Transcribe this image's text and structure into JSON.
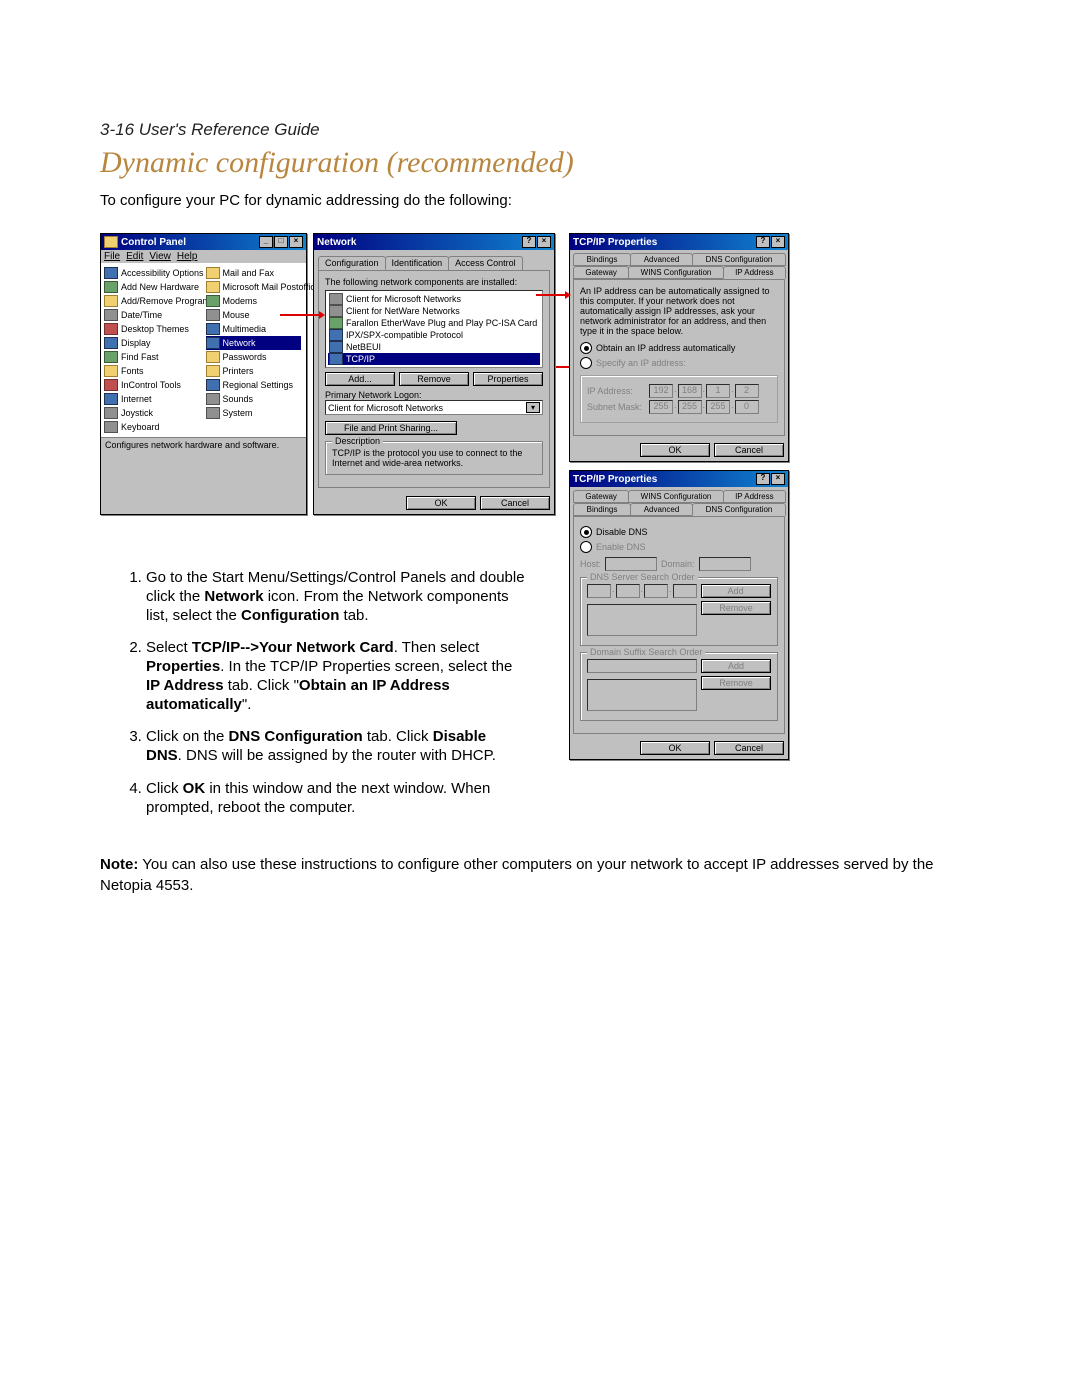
{
  "header": "3-16  User's Reference Guide",
  "title": "Dynamic configuration (recommended)",
  "intro": "To configure your PC for dynamic addressing do the following:",
  "control_panel": {
    "title": "Control Panel",
    "menu": [
      "File",
      "Edit",
      "View",
      "Help"
    ],
    "items_left": [
      "Accessibility Options",
      "Add New Hardware",
      "Add/Remove Programs",
      "Date/Time",
      "Desktop Themes",
      "Display",
      "Find Fast",
      "Fonts",
      "InControl Tools",
      "Internet",
      "Joystick",
      "Keyboard"
    ],
    "items_right": [
      "Mail and Fax",
      "Microsoft Mail Postoffice",
      "Modems",
      "Mouse",
      "Multimedia",
      "Network",
      "Passwords",
      "Printers",
      "Regional Settings",
      "Sounds",
      "System"
    ],
    "selected": "Network",
    "status": "Configures network hardware and software."
  },
  "network": {
    "title": "Network",
    "tabs": [
      "Configuration",
      "Identification",
      "Access Control"
    ],
    "list_label": "The following network components are installed:",
    "components": [
      "Client for Microsoft Networks",
      "Client for NetWare Networks",
      "Farallon EtherWave Plug and Play PC-ISA Card",
      "IPX/SPX-compatible Protocol",
      "NetBEUI",
      "TCP/IP"
    ],
    "selected": "TCP/IP",
    "add": "Add...",
    "remove": "Remove",
    "properties": "Properties",
    "logon_label": "Primary Network Logon:",
    "logon_value": "Client for Microsoft Networks",
    "fileprint": "File and Print Sharing...",
    "desc_legend": "Description",
    "desc_text": "TCP/IP is the protocol you use to connect to the Internet and wide-area networks.",
    "ok": "OK",
    "cancel": "Cancel"
  },
  "tcpip1": {
    "title": "TCP/IP Properties",
    "tabs_back": [
      "Bindings",
      "Advanced",
      "DNS Configuration"
    ],
    "tabs_front": [
      "Gateway",
      "WINS Configuration",
      "IP Address"
    ],
    "info": "An IP address can be automatically assigned to this computer. If your network does not automatically assign IP addresses, ask your network administrator for an address, and then type it in the space below.",
    "opt_auto": "Obtain an IP address automatically",
    "opt_spec": "Specify an IP address:",
    "ip_label": "IP Address:",
    "ip": [
      "192",
      "168",
      "1",
      "2"
    ],
    "mask_label": "Subnet Mask:",
    "mask": [
      "255",
      "255",
      "255",
      "0"
    ],
    "ok": "OK",
    "cancel": "Cancel"
  },
  "tcpip2": {
    "title": "TCP/IP Properties",
    "tabs_back": [
      "Gateway",
      "WINS Configuration",
      "IP Address"
    ],
    "tabs_front": [
      "Bindings",
      "Advanced",
      "DNS Configuration"
    ],
    "opt_disable": "Disable DNS",
    "opt_enable": "Enable DNS",
    "host_label": "Host:",
    "domain_label": "Domain:",
    "search_legend": "DNS Server Search Order",
    "suffix_legend": "Domain Suffix Search Order",
    "add": "Add",
    "remove": "Remove",
    "ok": "OK",
    "cancel": "Cancel"
  },
  "steps": {
    "s1a": "Go to the Start Menu/Settings/Control Panels and double click the ",
    "s1b": "Network",
    "s1c": " icon. From the Network components list, select the ",
    "s1d": "Configuration",
    "s1e": " tab.",
    "s2a": "Select ",
    "s2b": "TCP/IP-->Your Network Card",
    "s2c": ". Then select ",
    "s2d": "Properties",
    "s2e": ". In the TCP/IP Properties screen, select the ",
    "s2f": "IP Address",
    "s2g": " tab. Click \"",
    "s2h": "Obtain an IP Address automatically",
    "s2i": "\".",
    "s3a": "Click on the ",
    "s3b": "DNS Configuration",
    "s3c": " tab. Click ",
    "s3d": "Disable DNS",
    "s3e": ". DNS will be assigned by the router with DHCP.",
    "s4a": "Click ",
    "s4b": "OK",
    "s4c": " in this window and the next window. When prompted, reboot the computer."
  },
  "note_label": "Note:",
  "note_text": " You can also use these instructions to configure other computers on your network to accept IP addresses served by the Netopia 4553."
}
